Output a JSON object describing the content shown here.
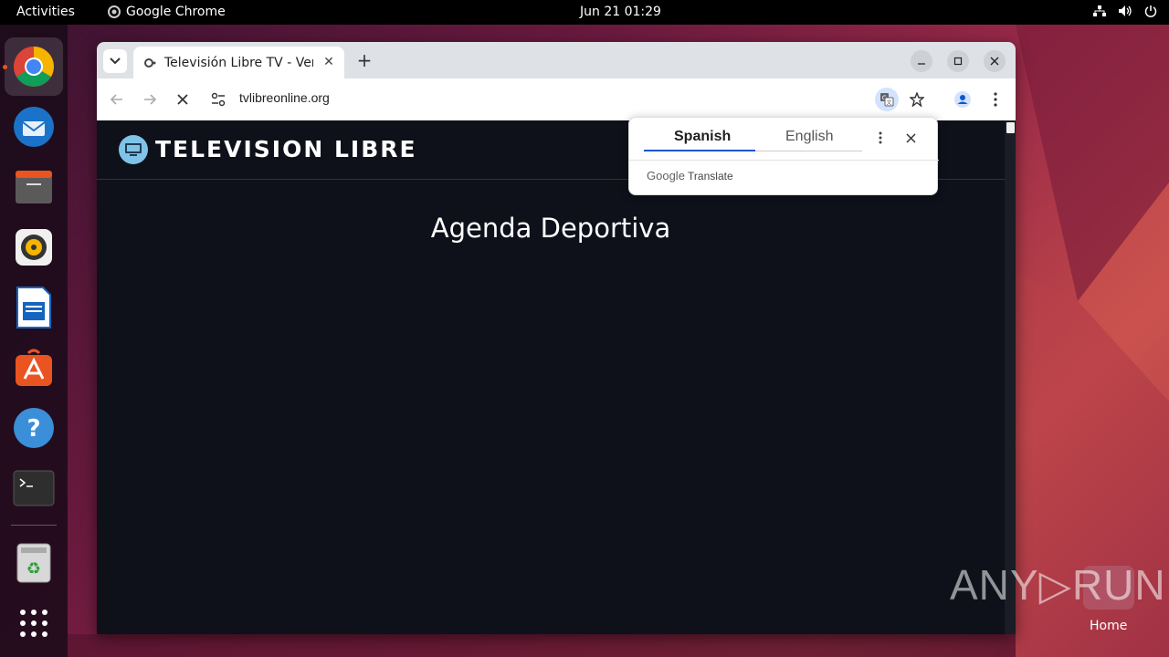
{
  "topbar": {
    "activities": "Activities",
    "app_name": "Google Chrome",
    "clock": "Jun 21  01:29"
  },
  "dock": {
    "apps": [
      "chrome-icon",
      "thunderbird-icon",
      "files-icon",
      "rhythmbox-icon",
      "writer-icon",
      "app-center-icon",
      "help-icon",
      "terminal-icon",
      "trash-icon",
      "app-grid-icon"
    ]
  },
  "browser": {
    "tab_title": "Televisión Libre TV - Ver",
    "url": "tvlibreonline.org"
  },
  "page": {
    "site_name": "TELEVISION LIBRE",
    "heading": "Agenda Deportiva"
  },
  "translate": {
    "source_lang": "Spanish",
    "target_lang": "English",
    "brand_google": "Google",
    "brand_translate": "Translate"
  },
  "desktop": {
    "watermark": "ANY▷RUN",
    "home_label": "Home"
  },
  "colors": {
    "chrome_tabstrip": "#dee1e6",
    "page_bg": "#0e1119",
    "accent_blue": "#0b57d0",
    "ubuntu_orange": "#e95420"
  }
}
